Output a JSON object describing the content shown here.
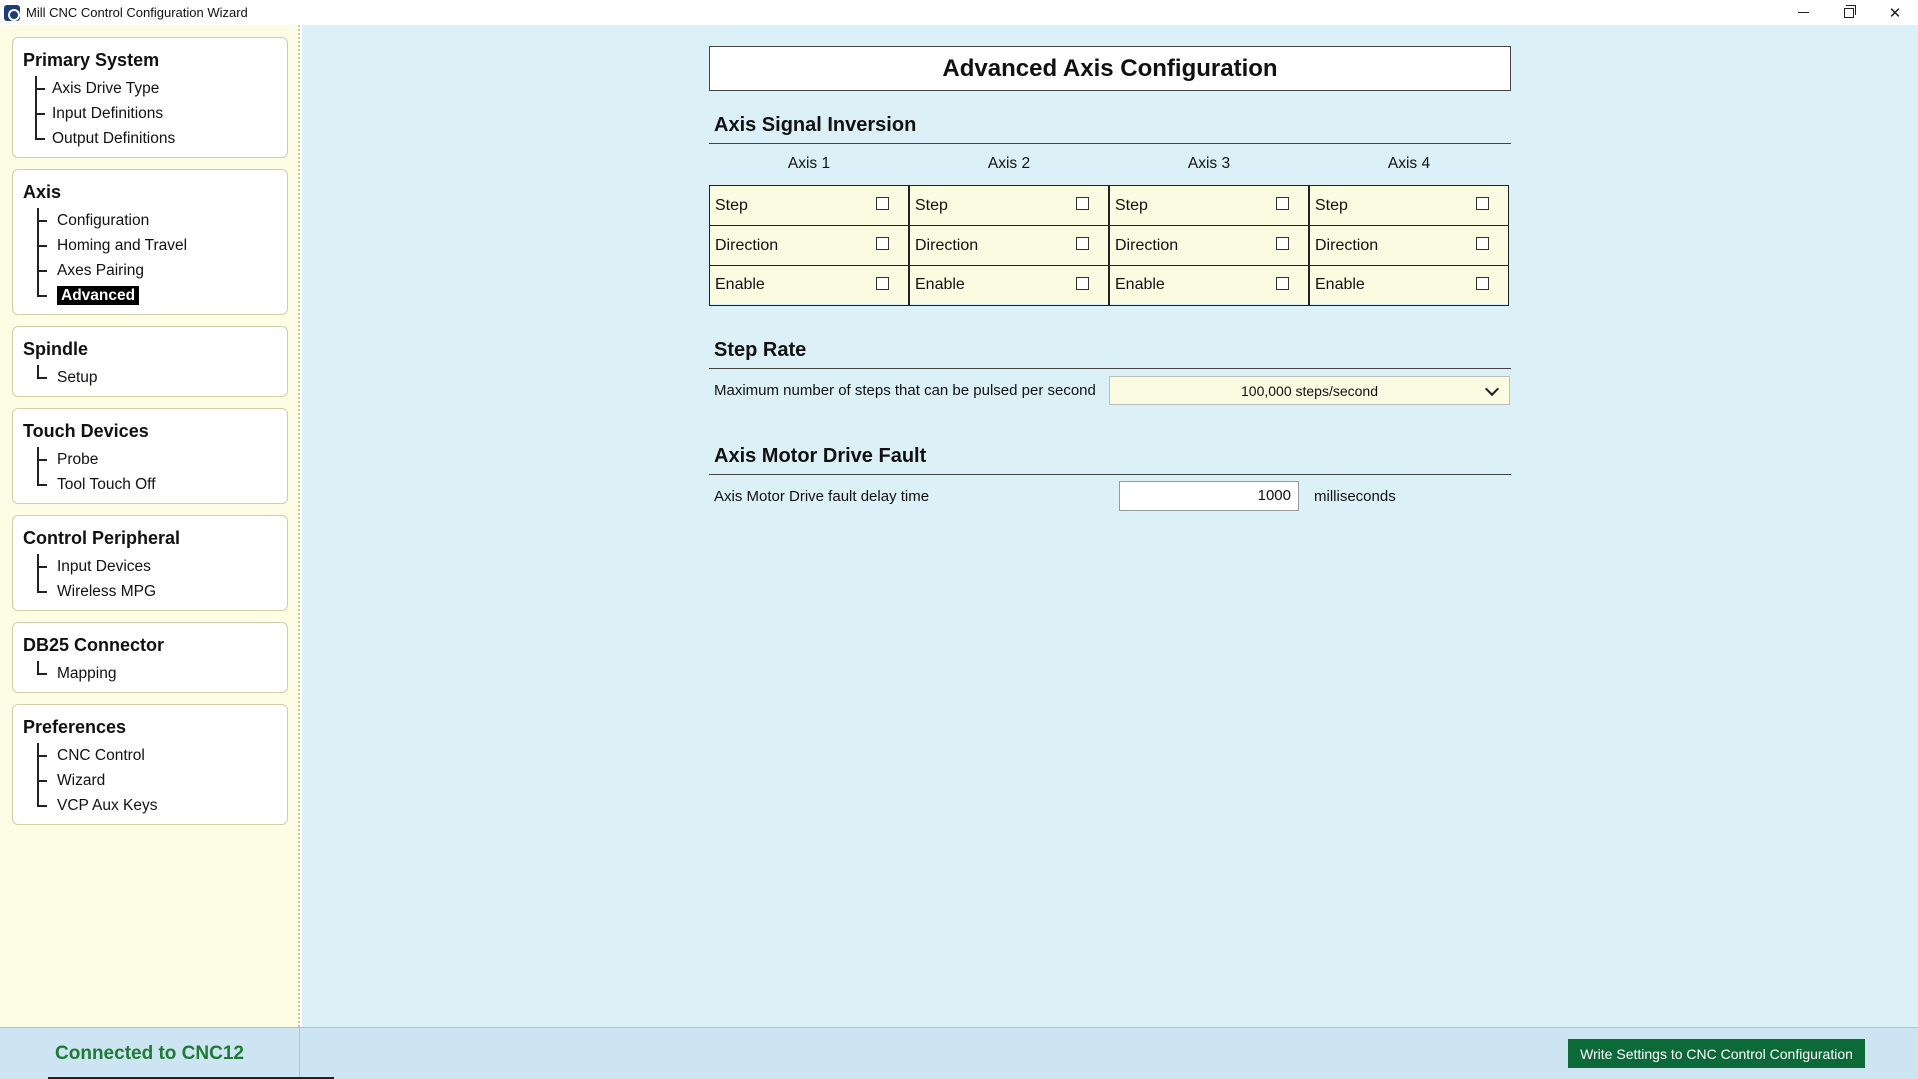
{
  "window": {
    "title": "Mill CNC Control Configuration Wizard"
  },
  "sidebar": {
    "groups": [
      {
        "title": "Primary System",
        "items": [
          "Axis Drive Type",
          "Input Definitions",
          "Output Definitions"
        ]
      },
      {
        "title": "Axis",
        "items": [
          "Configuration",
          "Homing and Travel",
          "Axes Pairing",
          "Advanced"
        ],
        "active_item": "Advanced"
      },
      {
        "title": "Spindle",
        "items": [
          "Setup"
        ]
      },
      {
        "title": "Touch Devices",
        "items": [
          "Probe",
          "Tool Touch Off"
        ]
      },
      {
        "title": "Control Peripheral",
        "items": [
          "Input Devices",
          "Wireless MPG"
        ]
      },
      {
        "title": "DB25 Connector",
        "items": [
          "Mapping"
        ]
      },
      {
        "title": "Preferences",
        "items": [
          "CNC Control",
          "Wizard",
          "VCP Aux Keys"
        ]
      }
    ]
  },
  "main": {
    "page_title": "Advanced Axis Configuration",
    "signal_inversion": {
      "title": "Axis Signal Inversion",
      "axes": [
        {
          "label": "Axis 1",
          "signals": [
            {
              "name": "Step",
              "checked": false
            },
            {
              "name": "Direction",
              "checked": false
            },
            {
              "name": "Enable",
              "checked": false
            }
          ]
        },
        {
          "label": "Axis 2",
          "signals": [
            {
              "name": "Step",
              "checked": false
            },
            {
              "name": "Direction",
              "checked": false
            },
            {
              "name": "Enable",
              "checked": false
            }
          ]
        },
        {
          "label": "Axis 3",
          "signals": [
            {
              "name": "Step",
              "checked": false
            },
            {
              "name": "Direction",
              "checked": false
            },
            {
              "name": "Enable",
              "checked": false
            }
          ]
        },
        {
          "label": "Axis 4",
          "signals": [
            {
              "name": "Step",
              "checked": false
            },
            {
              "name": "Direction",
              "checked": false
            },
            {
              "name": "Enable",
              "checked": false
            }
          ]
        }
      ]
    },
    "step_rate": {
      "title": "Step Rate",
      "label": "Maximum number of steps that can be pulsed per second",
      "selected": "100,000 steps/second"
    },
    "drive_fault": {
      "title": "Axis Motor Drive Fault",
      "label": "Axis Motor Drive fault delay time",
      "value": "1000",
      "unit": "milliseconds"
    }
  },
  "status": {
    "connection": "Connected to CNC12",
    "write_button": "Write Settings to CNC Control Configuration"
  },
  "colors": {
    "sidebar_bg": "#fdfde6",
    "main_bg": "#dbf0f7",
    "cell_bg": "#fbfbe1",
    "status_bg": "#cde4f3",
    "connected_text": "#1f7a34",
    "write_button_bg": "#0b6a38"
  }
}
